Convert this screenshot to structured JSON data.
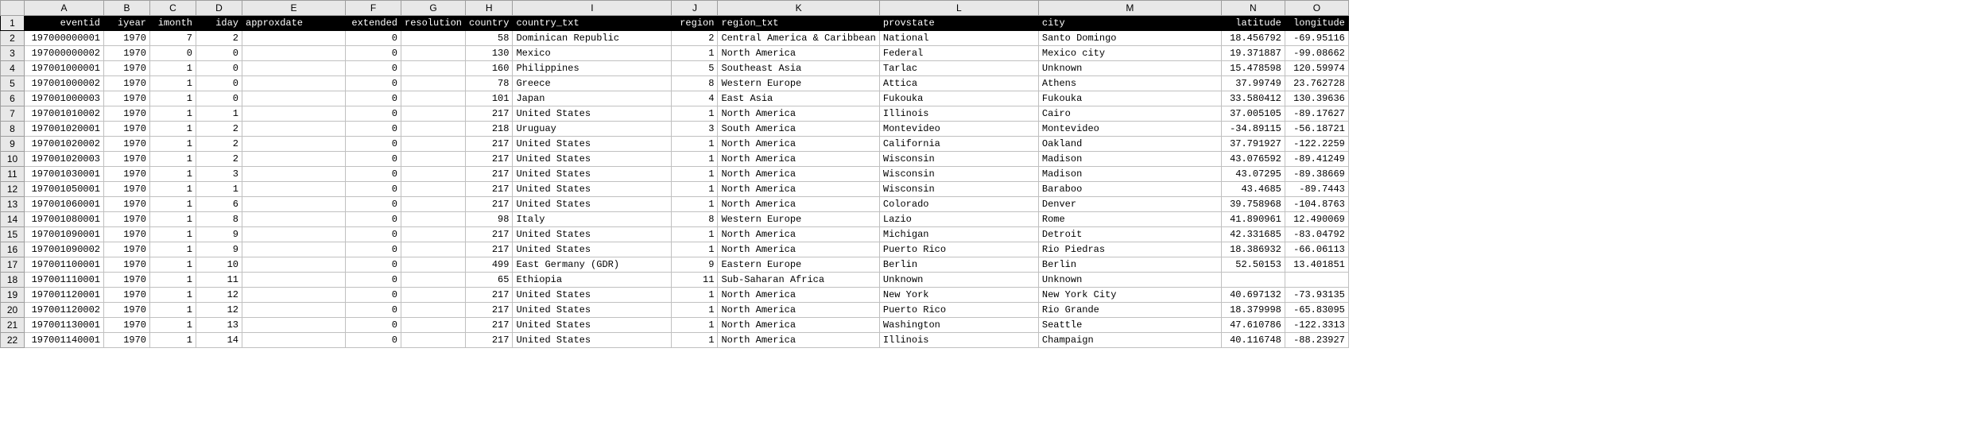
{
  "columns": [
    "A",
    "B",
    "C",
    "D",
    "E",
    "F",
    "G",
    "H",
    "I",
    "J",
    "K",
    "L",
    "M",
    "N",
    "O"
  ],
  "col_widths": [
    "wA",
    "wB",
    "wC",
    "wD",
    "wE",
    "wF",
    "wG",
    "wH",
    "wI",
    "wJ",
    "wK",
    "wL",
    "wM",
    "wN",
    "wO"
  ],
  "headers": [
    "eventid",
    "iyear",
    "imonth",
    "iday",
    "approxdate",
    "extended",
    "resolution",
    "country",
    "country_txt",
    "region",
    "region_txt",
    "provstate",
    "city",
    "latitude",
    "longitude"
  ],
  "header_align": [
    "num",
    "num",
    "num",
    "num",
    "txt",
    "num",
    "txt",
    "num",
    "txt",
    "num",
    "txt",
    "txt",
    "txt",
    "num",
    "num"
  ],
  "rows": [
    {
      "n": 2,
      "c": [
        "197000000001",
        "1970",
        "7",
        "2",
        "",
        "0",
        "",
        "58",
        "Dominican Republic",
        "2",
        "Central America & Caribbean",
        "National",
        "Santo Domingo",
        "18.456792",
        "-69.95116"
      ]
    },
    {
      "n": 3,
      "c": [
        "197000000002",
        "1970",
        "0",
        "0",
        "",
        "0",
        "",
        "130",
        "Mexico",
        "1",
        "North America",
        "Federal",
        "Mexico city",
        "19.371887",
        "-99.08662"
      ]
    },
    {
      "n": 4,
      "c": [
        "197001000001",
        "1970",
        "1",
        "0",
        "",
        "0",
        "",
        "160",
        "Philippines",
        "5",
        "Southeast Asia",
        "Tarlac",
        "Unknown",
        "15.478598",
        "120.59974"
      ]
    },
    {
      "n": 5,
      "c": [
        "197001000002",
        "1970",
        "1",
        "0",
        "",
        "0",
        "",
        "78",
        "Greece",
        "8",
        "Western Europe",
        "Attica",
        "Athens",
        "37.99749",
        "23.762728"
      ]
    },
    {
      "n": 6,
      "c": [
        "197001000003",
        "1970",
        "1",
        "0",
        "",
        "0",
        "",
        "101",
        "Japan",
        "4",
        "East Asia",
        "Fukouka",
        "Fukouka",
        "33.580412",
        "130.39636"
      ]
    },
    {
      "n": 7,
      "c": [
        "197001010002",
        "1970",
        "1",
        "1",
        "",
        "0",
        "",
        "217",
        "United States",
        "1",
        "North America",
        "Illinois",
        "Cairo",
        "37.005105",
        "-89.17627"
      ]
    },
    {
      "n": 8,
      "c": [
        "197001020001",
        "1970",
        "1",
        "2",
        "",
        "0",
        "",
        "218",
        "Uruguay",
        "3",
        "South America",
        "Montevideo",
        "Montevideo",
        "-34.89115",
        "-56.18721"
      ]
    },
    {
      "n": 9,
      "c": [
        "197001020002",
        "1970",
        "1",
        "2",
        "",
        "0",
        "",
        "217",
        "United States",
        "1",
        "North America",
        "California",
        "Oakland",
        "37.791927",
        "-122.2259"
      ]
    },
    {
      "n": 10,
      "c": [
        "197001020003",
        "1970",
        "1",
        "2",
        "",
        "0",
        "",
        "217",
        "United States",
        "1",
        "North America",
        "Wisconsin",
        "Madison",
        "43.076592",
        "-89.41249"
      ]
    },
    {
      "n": 11,
      "c": [
        "197001030001",
        "1970",
        "1",
        "3",
        "",
        "0",
        "",
        "217",
        "United States",
        "1",
        "North America",
        "Wisconsin",
        "Madison",
        "43.07295",
        "-89.38669"
      ]
    },
    {
      "n": 12,
      "c": [
        "197001050001",
        "1970",
        "1",
        "1",
        "",
        "0",
        "",
        "217",
        "United States",
        "1",
        "North America",
        "Wisconsin",
        "Baraboo",
        "43.4685",
        "-89.7443"
      ]
    },
    {
      "n": 13,
      "c": [
        "197001060001",
        "1970",
        "1",
        "6",
        "",
        "0",
        "",
        "217",
        "United States",
        "1",
        "North America",
        "Colorado",
        "Denver",
        "39.758968",
        "-104.8763"
      ]
    },
    {
      "n": 14,
      "c": [
        "197001080001",
        "1970",
        "1",
        "8",
        "",
        "0",
        "",
        "98",
        "Italy",
        "8",
        "Western Europe",
        "Lazio",
        "Rome",
        "41.890961",
        "12.490069"
      ]
    },
    {
      "n": 15,
      "c": [
        "197001090001",
        "1970",
        "1",
        "9",
        "",
        "0",
        "",
        "217",
        "United States",
        "1",
        "North America",
        "Michigan",
        "Detroit",
        "42.331685",
        "-83.04792"
      ]
    },
    {
      "n": 16,
      "c": [
        "197001090002",
        "1970",
        "1",
        "9",
        "",
        "0",
        "",
        "217",
        "United States",
        "1",
        "North America",
        "Puerto Rico",
        "Rio Piedras",
        "18.386932",
        "-66.06113"
      ]
    },
    {
      "n": 17,
      "c": [
        "197001100001",
        "1970",
        "1",
        "10",
        "",
        "0",
        "",
        "499",
        "East Germany (GDR)",
        "9",
        "Eastern Europe",
        "Berlin",
        "Berlin",
        "52.50153",
        "13.401851"
      ]
    },
    {
      "n": 18,
      "c": [
        "197001110001",
        "1970",
        "1",
        "11",
        "",
        "0",
        "",
        "65",
        "Ethiopia",
        "11",
        "Sub-Saharan Africa",
        "Unknown",
        "Unknown",
        "",
        ""
      ]
    },
    {
      "n": 19,
      "c": [
        "197001120001",
        "1970",
        "1",
        "12",
        "",
        "0",
        "",
        "217",
        "United States",
        "1",
        "North America",
        "New York",
        "New York City",
        "40.697132",
        "-73.93135"
      ]
    },
    {
      "n": 20,
      "c": [
        "197001120002",
        "1970",
        "1",
        "12",
        "",
        "0",
        "",
        "217",
        "United States",
        "1",
        "North America",
        "Puerto Rico",
        "Rio Grande",
        "18.379998",
        "-65.83095"
      ]
    },
    {
      "n": 21,
      "c": [
        "197001130001",
        "1970",
        "1",
        "13",
        "",
        "0",
        "",
        "217",
        "United States",
        "1",
        "North America",
        "Washington",
        "Seattle",
        "47.610786",
        "-122.3313"
      ]
    },
    {
      "n": 22,
      "c": [
        "197001140001",
        "1970",
        "1",
        "14",
        "",
        "0",
        "",
        "217",
        "United States",
        "1",
        "North America",
        "Illinois",
        "Champaign",
        "40.116748",
        "-88.23927"
      ]
    }
  ],
  "col_align": [
    "num",
    "num",
    "num",
    "num",
    "txt",
    "num",
    "txt",
    "num",
    "txt",
    "num",
    "txt",
    "txt",
    "txt",
    "num",
    "num"
  ]
}
